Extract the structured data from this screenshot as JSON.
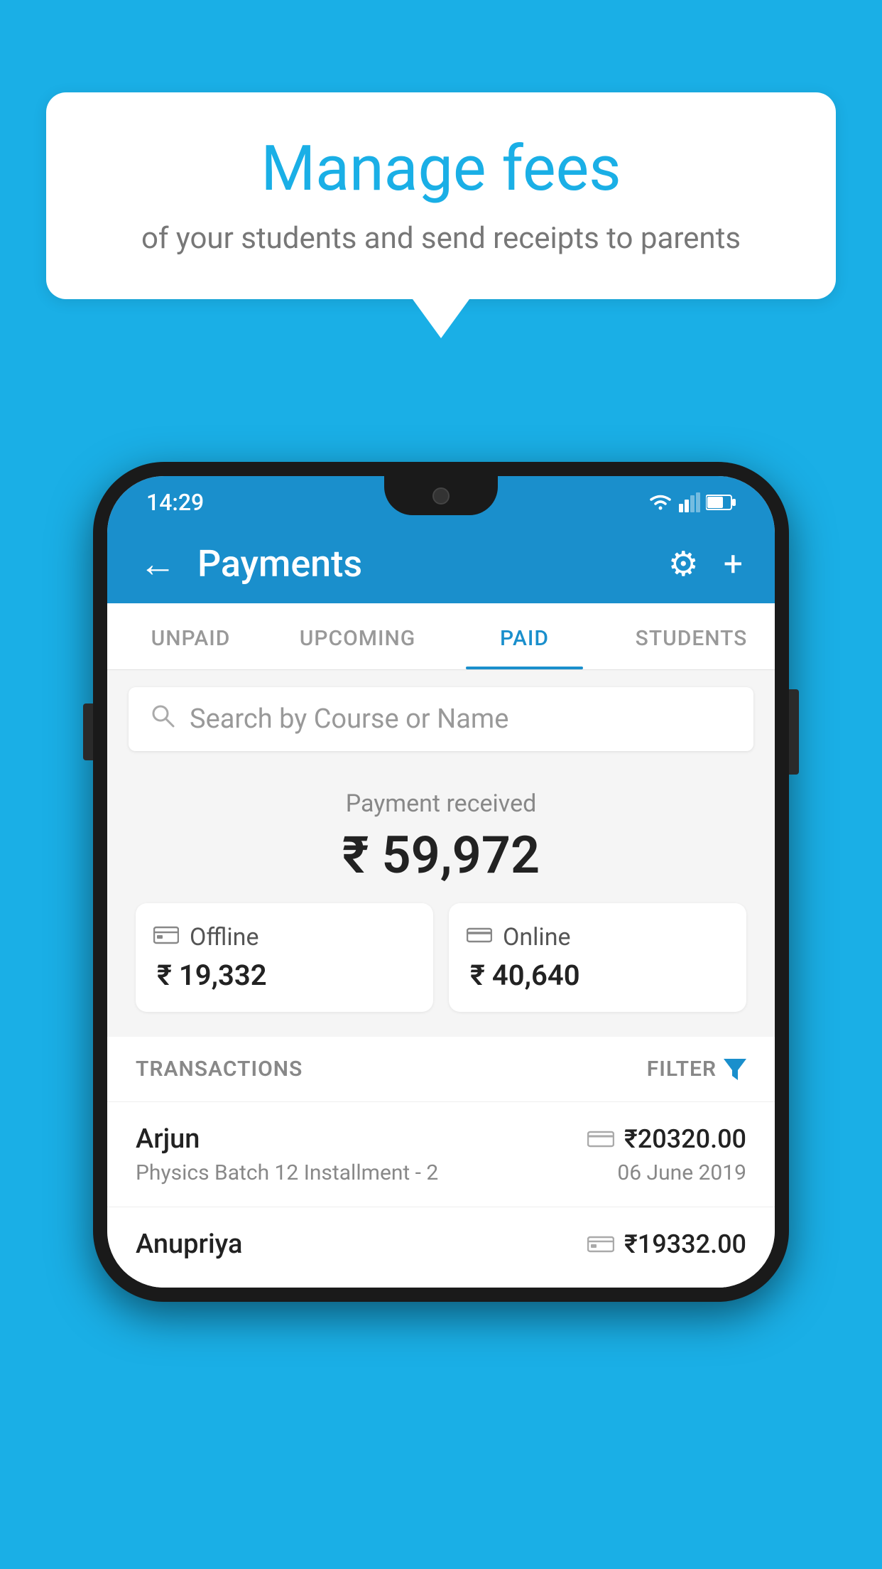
{
  "background_color": "#1AAFE6",
  "speech_bubble": {
    "title": "Manage fees",
    "subtitle": "of your students and send receipts to parents"
  },
  "status_bar": {
    "time": "14:29"
  },
  "app_header": {
    "title": "Payments",
    "back_label": "←",
    "settings_label": "⚙",
    "add_label": "+"
  },
  "tabs": [
    {
      "label": "UNPAID",
      "active": false
    },
    {
      "label": "UPCOMING",
      "active": false
    },
    {
      "label": "PAID",
      "active": true
    },
    {
      "label": "STUDENTS",
      "active": false
    }
  ],
  "search": {
    "placeholder": "Search by Course or Name"
  },
  "payment_summary": {
    "label": "Payment received",
    "amount": "₹ 59,972",
    "offline_label": "Offline",
    "offline_amount": "₹ 19,332",
    "online_label": "Online",
    "online_amount": "₹ 40,640"
  },
  "transactions": {
    "label": "TRANSACTIONS",
    "filter_label": "FILTER",
    "rows": [
      {
        "name": "Arjun",
        "course": "Physics Batch 12 Installment - 2",
        "amount": "₹20320.00",
        "date": "06 June 2019",
        "payment_type": "card"
      },
      {
        "name": "Anupriya",
        "course": "",
        "amount": "₹19332.00",
        "date": "",
        "payment_type": "offline"
      }
    ]
  }
}
